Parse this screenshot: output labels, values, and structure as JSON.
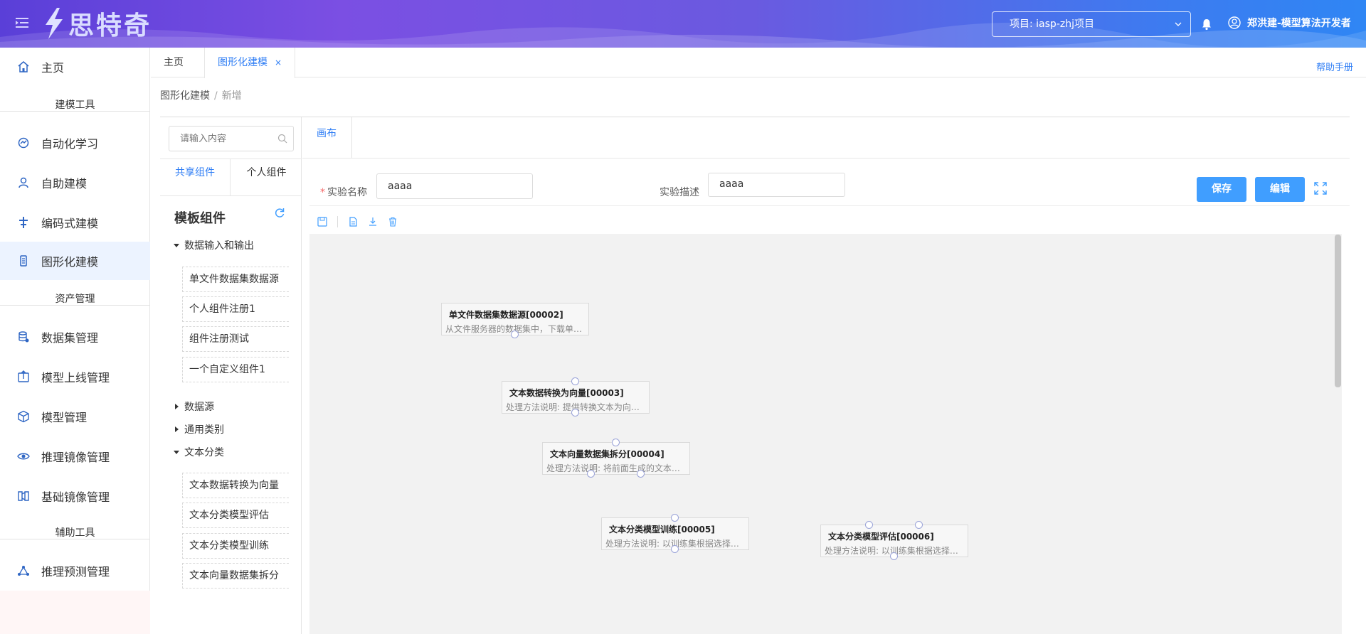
{
  "header": {
    "logo_text": "思特奇",
    "project_select": "项目: iasp-zhj项目",
    "user_name": "郑洪建-模型算法开发者"
  },
  "sidebar": {
    "items": [
      {
        "label": "主页",
        "icon": "home-icon"
      },
      {
        "group": "建模工具"
      },
      {
        "label": "自动化学习",
        "icon": "auto-learn-icon"
      },
      {
        "label": "自助建模",
        "icon": "self-model-icon"
      },
      {
        "label": "编码式建模",
        "icon": "code-model-icon"
      },
      {
        "label": "图形化建模",
        "icon": "graph-model-icon",
        "active": true
      },
      {
        "group": "资产管理"
      },
      {
        "label": "数据集管理",
        "icon": "database-icon"
      },
      {
        "label": "模型上线管理",
        "icon": "upload-icon"
      },
      {
        "label": "模型管理",
        "icon": "cube-icon"
      },
      {
        "label": "推理镜像管理",
        "icon": "inference-image-icon"
      },
      {
        "label": "基础镜像管理",
        "icon": "base-image-icon"
      },
      {
        "group": "辅助工具"
      },
      {
        "label": "推理预测管理",
        "icon": "predict-icon"
      }
    ]
  },
  "tabs": {
    "home": "主页",
    "active": "图形化建模",
    "close": "×",
    "help": "帮助手册"
  },
  "breadcrumb": {
    "root": "图形化建模",
    "separator": "/",
    "current": "新增"
  },
  "panel": {
    "search_placeholder": "请输入内容",
    "tab_shared": "共享组件",
    "tab_personal": "个人组件",
    "title": "模板组件",
    "tree": [
      {
        "label": "数据输入和输出",
        "expanded": true,
        "children": [
          "单文件数据集数据源",
          "个人组件注册1",
          "组件注册测试",
          "一个自定义组件1"
        ]
      },
      {
        "label": "数据源",
        "expanded": false
      },
      {
        "label": "通用类别",
        "expanded": false
      },
      {
        "label": "文本分类",
        "expanded": true,
        "children": [
          "文本数据转换为向量",
          "文本分类模型评估",
          "文本分类模型训练",
          "文本向量数据集拆分"
        ]
      }
    ]
  },
  "canvas": {
    "tab": "画布",
    "name_label": "实验名称",
    "required_mark": "*",
    "name_value": "aaaa",
    "desc_label": "实验描述",
    "desc_value": "aaaa",
    "save": "保存",
    "edit": "编辑",
    "nodes": [
      {
        "title": "单文件数据集数据源[00002]",
        "desc": "从文件服务器的数据集中，下载单…"
      },
      {
        "title": "文本数据转换为向量[00003]",
        "desc": "处理方法说明:  提供转换文本为向…"
      },
      {
        "title": "文本向量数据集拆分[00004]",
        "desc": "处理方法说明:  将前面生成的文本…"
      },
      {
        "title": "文本分类模型训练[00005]",
        "desc": "处理方法说明:  以训练集根据选择…"
      },
      {
        "title": "文本分类模型评估[00006]",
        "desc": "处理方法说明:  以训练集根据选择…"
      }
    ]
  }
}
